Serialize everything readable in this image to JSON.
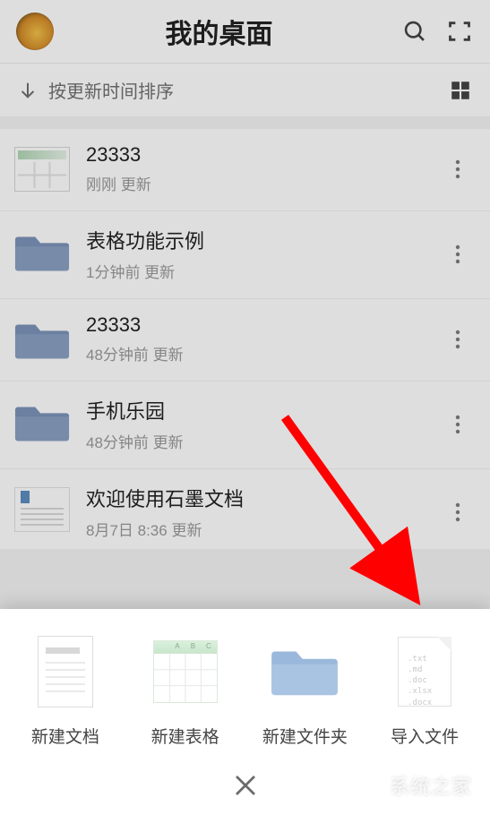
{
  "header": {
    "title": "我的桌面"
  },
  "sort": {
    "label": "按更新时间排序"
  },
  "files": [
    {
      "title": "23333",
      "subtitle": "刚刚  更新",
      "type": "sheet"
    },
    {
      "title": "表格功能示例",
      "subtitle": "1分钟前  更新",
      "type": "folder"
    },
    {
      "title": "23333",
      "subtitle": "48分钟前  更新",
      "type": "folder"
    },
    {
      "title": "手机乐园",
      "subtitle": "48分钟前  更新",
      "type": "folder"
    },
    {
      "title": "欢迎使用石墨文档",
      "subtitle": "8月7日 8:36  更新",
      "type": "doc"
    }
  ],
  "sheet_items": [
    {
      "label": "新建文档"
    },
    {
      "label": "新建表格"
    },
    {
      "label": "新建文件夹"
    },
    {
      "label": "导入文件"
    }
  ],
  "import_ext": ".txt\n.md\n.doc\n.xlsx\n.docx",
  "watermark": {
    "text": "系统之家"
  }
}
